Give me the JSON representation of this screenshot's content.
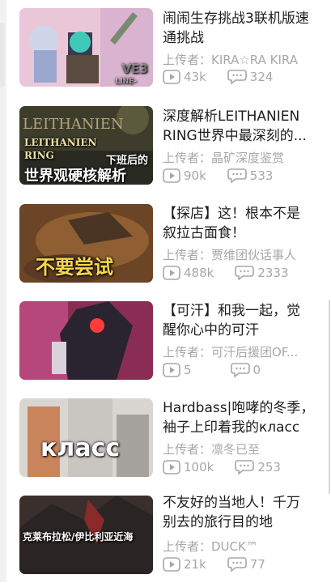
{
  "videos": [
    {
      "title_line1": "闹闹生存挑战3联机版速",
      "title_line2": "通挑战",
      "uploader": "上传者：KIRA☆RA KIRA",
      "plays": "43k",
      "comments": "324",
      "thumb_text": "VE3",
      "thumb_text2": "LINE-"
    },
    {
      "title_line1": "深度解析LEITHANIEN",
      "title_line2": "RING世界中最深刻的...",
      "uploader": "上传者：晶矿深度鉴赏",
      "plays": "90k",
      "comments": "533",
      "thumb_text": "LEITHANIEN",
      "thumb_text2": "LEITHANIEN",
      "thumb_text3": "RING",
      "thumb_text4": "下班后的",
      "thumb_text5": "世界观硬核解析"
    },
    {
      "title_line1": "【探店】这！根本不是",
      "title_line2": "叙拉古面食！",
      "uploader": "上传者：贾维团伙话事人",
      "plays": "488k",
      "comments": "2333",
      "thumb_text": "不要尝试"
    },
    {
      "title_line1": "【可汗】和我一起，觉",
      "title_line2": "醒你心中的可汗",
      "uploader": "上传者：可汗后援团OF...",
      "plays": "5",
      "comments": "0"
    },
    {
      "title_line1": "Hardbass|咆哮的冬季，",
      "title_line2": "袖子上印着我的класс",
      "uploader": "上传者：凛冬已至",
      "plays": "100k",
      "comments": "253",
      "thumb_text": "класс"
    },
    {
      "title_line1": "不友好的当地人！千万",
      "title_line2": "别去的旅行目的地",
      "uploader": "上传者：DUCK™",
      "plays": "21k",
      "comments": "77",
      "thumb_text": "克莱布拉松/伊比利亚近海"
    }
  ],
  "colors": {
    "text": "#1d1d1d",
    "meta": "#a7a7a7",
    "background": "#ffffff"
  },
  "icons": {
    "plays": "play-count-icon",
    "comments": "comment-count-icon"
  }
}
